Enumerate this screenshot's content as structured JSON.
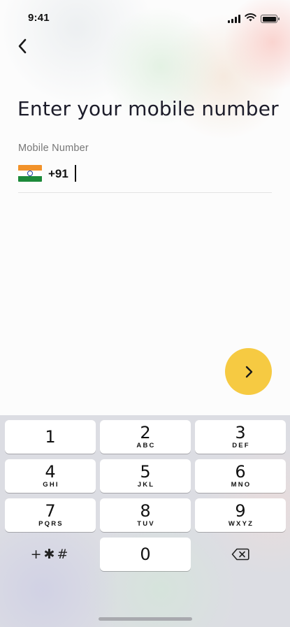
{
  "status_bar": {
    "time": "9:41",
    "icons": [
      "signal-icon",
      "wifi-icon",
      "battery-icon"
    ]
  },
  "header": {
    "back_icon": "chevron-left-icon"
  },
  "main": {
    "title": "Enter your mobile number",
    "field_label": "Mobile Number",
    "country_flag": "india-flag-icon",
    "country_code": "+91",
    "phone_value": "",
    "next_icon": "chevron-right-icon",
    "accent_color": "#F6CA42"
  },
  "keypad": {
    "keys": [
      {
        "digit": "1",
        "letters": ""
      },
      {
        "digit": "2",
        "letters": "ABC"
      },
      {
        "digit": "3",
        "letters": "DEF"
      },
      {
        "digit": "4",
        "letters": "GHI"
      },
      {
        "digit": "5",
        "letters": "JKL"
      },
      {
        "digit": "6",
        "letters": "MNO"
      },
      {
        "digit": "7",
        "letters": "PQRS"
      },
      {
        "digit": "8",
        "letters": "TUV"
      },
      {
        "digit": "9",
        "letters": "WXYZ"
      },
      {
        "digit": "0",
        "letters": ""
      }
    ],
    "symbols_label": "+✱#",
    "delete_icon": "backspace-icon"
  }
}
